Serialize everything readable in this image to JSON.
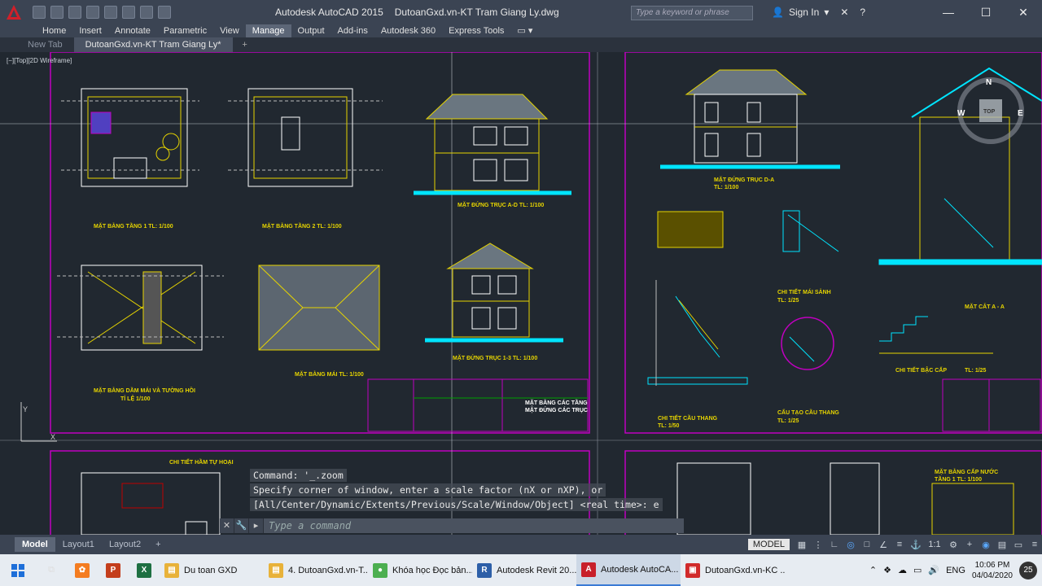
{
  "window": {
    "app_name": "Autodesk AutoCAD 2015",
    "file_name": "DutoanGxd.vn-KT Tram Giang Ly.dwg",
    "search_placeholder": "Type a keyword or phrase",
    "sign_in": "Sign In"
  },
  "ribbon_tabs": [
    "Home",
    "Insert",
    "Annotate",
    "Parametric",
    "View",
    "Manage",
    "Output",
    "Add-ins",
    "Autodesk 360",
    "Express Tools"
  ],
  "active_ribbon_tab": "Manage",
  "doc_tabs": {
    "new_tab": "New Tab",
    "active": "DutoanGxd.vn-KT Tram Giang Ly*"
  },
  "viewport_label": "[−][Top][2D Wireframe]",
  "viewcube": {
    "top": "TOP",
    "n": "N",
    "w": "W",
    "e": "E"
  },
  "drawing_titles": {
    "floor1": "MẶT BẰNG TẦNG 1 TL: 1/100",
    "floor2": "MẶT BẰNG TẦNG 2 TL: 1/100",
    "elev_ad": "MẶT ĐỨNG TRỤC A-D TL: 1/100",
    "elev_13": "MẶT ĐỨNG TRỤC 1-3 TL: 1/100",
    "roof": "MẶT BẰNG MÁI TL: 1/100",
    "roof_beam": "MẶT BẰNG DẦM MÁI VÀ TƯỜNG HỒI",
    "roof_beam_scale": "TỈ LỆ 1/100",
    "elev_da": "MẶT ĐỨNG TRỤC D-A",
    "elev_da_scale": "TL: 1/100",
    "sink_detail": "CHI TIẾT MÁI SẢNH",
    "sink_scale": "TL: 1/25",
    "section_aa": "MẶT CẮT A - A",
    "stair_detail": "CHI TIẾT CẦU THANG",
    "stair_scale": "TL: 1/50",
    "stair_struct": "CẤU TẠO CẦU THANG",
    "stair_struct_scale": "TL: 1/25",
    "step_detail": "CHI TIẾT BẬC CẤP",
    "step_scale": "TL: 1/25",
    "septic": "CHI TIẾT HẦM TỰ HOẠI",
    "water_plan": "MẶT BẰNG CẤP NƯỚC",
    "water_plan_sub": "TẦNG 1 TL: 1/100",
    "sheet_title_1": "MẶT BẰNG CÁC TẦNG",
    "sheet_title_2": "MẶT ĐỨNG CÁC TRỤC"
  },
  "command": {
    "line1": "Command: '_.zoom",
    "line2": "Specify corner of window, enter a scale factor (nX or nXP), or",
    "line3": "[All/Center/Dynamic/Extents/Previous/Scale/Window/Object] <real time>:  e",
    "input_placeholder": "Type a command"
  },
  "layout_tabs": [
    "Model",
    "Layout1",
    "Layout2"
  ],
  "active_layout": "Model",
  "status": {
    "model": "MODEL",
    "scale": "1:1"
  },
  "taskbar": {
    "items": [
      {
        "label": "Du toan GXD",
        "color": "#e8b23a",
        "glyph": "▤"
      },
      {
        "label": "4. DutoanGxd.vn-T...",
        "color": "#e8b23a",
        "glyph": "▤"
      },
      {
        "label": "Khóa học Đọc bản...",
        "color": "#4caf50",
        "glyph": "●"
      },
      {
        "label": "Autodesk Revit 20...",
        "color": "#2d5fa8",
        "glyph": "R"
      },
      {
        "label": "Autodesk AutoCA...",
        "color": "#c8202a",
        "glyph": "A"
      },
      {
        "label": "DutoanGxd.vn-KC ...",
        "color": "#d12a2a",
        "glyph": "▣"
      }
    ],
    "active_index": 4,
    "lang": "ENG",
    "time": "10:06 PM",
    "date": "04/04/2020",
    "notifications": "25"
  },
  "colors": {
    "canvas_bg": "#212830",
    "titlebar_bg": "#3b4453",
    "drawing_yellow": "#e6d400",
    "drawing_cyan": "#00e5ff",
    "drawing_magenta": "#c000c0",
    "drawing_white": "#ffffff"
  }
}
